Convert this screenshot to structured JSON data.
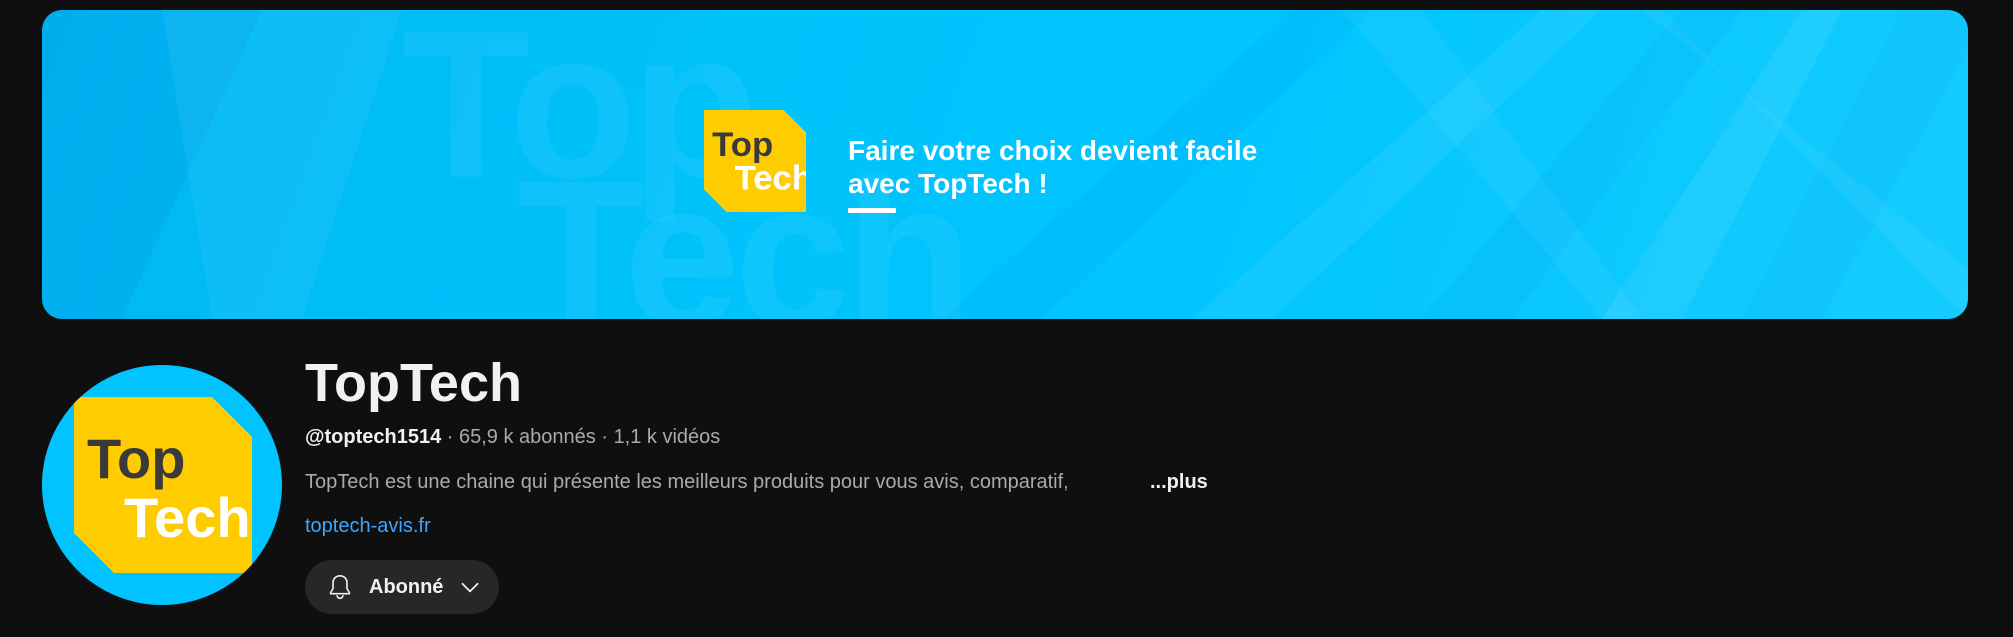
{
  "banner": {
    "logo_top": "Top",
    "logo_bottom": "Tech",
    "tagline_line1": "Faire votre choix devient facile",
    "tagline_line2": "avec TopTech !",
    "background_word_top": "Top",
    "background_word_bottom": "Tech",
    "colors": {
      "background": "#00c3ff",
      "logo_yellow": "#ffcc00",
      "logo_dark": "#3a3a3a"
    }
  },
  "avatar": {
    "logo_top": "Top",
    "logo_bottom": "Tech"
  },
  "channel": {
    "name": "TopTech",
    "handle": "@toptech1514",
    "subscribers": "65,9 k abonnés",
    "videos": "1,1 k vidéos",
    "separator": " · ",
    "description": "TopTech est une chaine qui présente les meilleurs produits pour vous avis, comparatif,",
    "more_label": "...plus",
    "website": "toptech-avis.fr"
  },
  "subscribe_button": {
    "label": "Abonné",
    "icon": "bell-icon",
    "dropdown_icon": "chevron-down-icon"
  },
  "colors": {
    "page_background": "#0f0f0f",
    "link": "#3ea6ff",
    "button_background": "#272727"
  }
}
